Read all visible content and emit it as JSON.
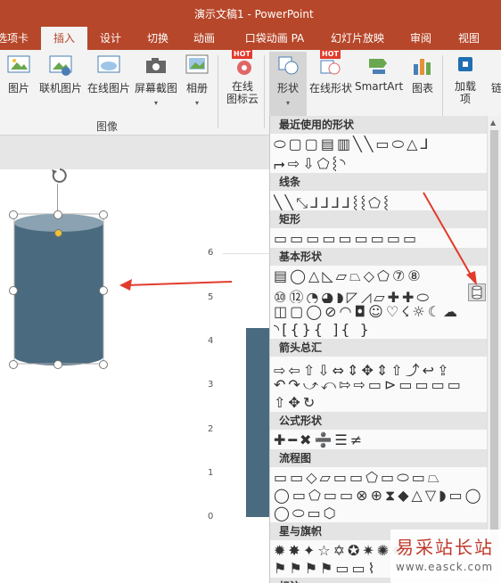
{
  "titlebar": {
    "title": "演示文稿1 - PowerPoint",
    "bg_color": "#b7472a"
  },
  "tabs": [
    {
      "label": "选项卡",
      "active": false
    },
    {
      "label": "插入",
      "active": true
    },
    {
      "label": "设计",
      "active": false
    },
    {
      "label": "切换",
      "active": false
    },
    {
      "label": "动画",
      "active": false
    },
    {
      "label": "口袋动画 PA",
      "active": false
    },
    {
      "label": "幻灯片放映",
      "active": false
    },
    {
      "label": "审阅",
      "active": false
    },
    {
      "label": "视图",
      "active": false
    }
  ],
  "ribbon": {
    "picture": "图片",
    "online_picture": "联机图片",
    "online_picture2": "在线图片",
    "screenshot": "屏幕截图",
    "album": "相册",
    "images_group": "图像",
    "online_icons_1": "在线",
    "online_icons_2": "图标云",
    "shapes": "形状",
    "online_shapes": "在线形状",
    "smartart": "SmartArt",
    "chart": "图表",
    "addins_1": "加载",
    "addins_2": "项",
    "hot": "HOT",
    "more": "链"
  },
  "chart": {
    "y_ticks": [
      "6",
      "5",
      "4",
      "3",
      "2",
      "1",
      "0"
    ],
    "bar_color": "#4a6a7f"
  },
  "shape": {
    "fill_color": "#4a6a7f",
    "top_color": "#8aa2b2"
  },
  "gallery": {
    "sections": {
      "recent": "最近使用的形状",
      "lines": "线条",
      "rect": "矩形",
      "basic": "基本形状",
      "arrows": "箭头总汇",
      "equation": "公式形状",
      "flowchart": "流程图",
      "stars": "星与旗帜",
      "callouts": "标注"
    },
    "rows": {
      "recent1": "⬭▢▢▤▥╲╲▭⬭△⅃",
      "recent2": "⮣⇨⇩⬠⸾◝",
      "lines1": "╲╲⤡⅃⅃⅃⅃⸾⸾⬠⸾",
      "rect1": "▭▭▭▭▭▭▭▭▭",
      "basic1": "▤◯△◺▱⏢◇⬠⑦⑧",
      "basic2": "⑩⑫◔◕◗◸◿▱✚✚⬭",
      "basic3": "◫▢◯⊘◠◘☺♡☇☼☾☁",
      "basic4": "◝[{}{ ]{ }",
      "arrows1": "⇨⇦⇧⇩⇔⇕✥⇕⇧⤴↩⇪",
      "arrows2": "↶↷⤻⤺⇰⇨▭⊳▭▭▭▭",
      "arrows3": "⇧✥↻",
      "eq1": "✚━✖➗☰≠",
      "flow1": "▭▭◇▱▭▭⬠▭⬭▭⏢",
      "flow2": "◯▭⬠▭▭⊗⊕⧗◆△▽◗▭◯",
      "flow3": "◯⬭▭⬡",
      "stars1": "✹✸✦☆✡✪✷✺✹",
      "stars2": "⚑⚑⚑⚑▭▭⌇"
    }
  },
  "watermark": {
    "cn": "易采站长站",
    "url": "www.easck.com"
  }
}
